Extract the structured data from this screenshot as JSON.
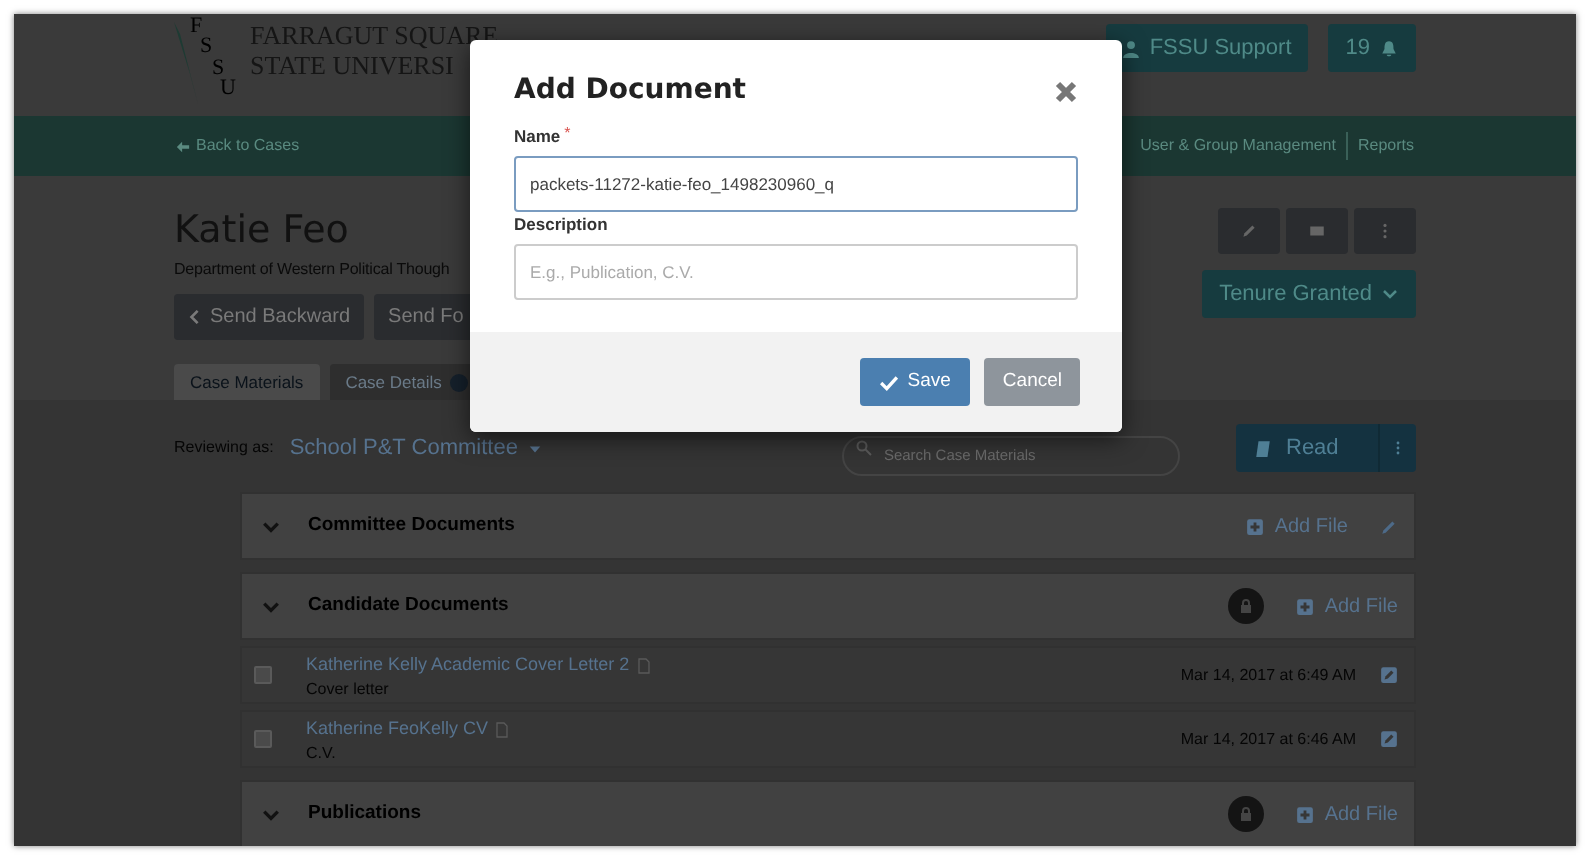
{
  "header": {
    "logo_letters": [
      "F",
      "S",
      "S",
      "U"
    ],
    "logo_lines": [
      "FARRAGUT SQUARE",
      "STATE UNIVERSI"
    ],
    "support_button": "FSSU Support",
    "notification_count": "19"
  },
  "nav": {
    "back_link": "Back to Cases",
    "links": [
      "User & Group Management",
      "Reports"
    ]
  },
  "case": {
    "name": "Katie Feo",
    "department": "Department of Western Political Though",
    "actions": [
      "Send Backward",
      "Send Fo"
    ],
    "status": "Tenure Granted"
  },
  "tabs": [
    {
      "label": "Case Materials",
      "selected": true
    },
    {
      "label": "Case Details",
      "selected": false
    }
  ],
  "reviewing": {
    "label": "Reviewing as:",
    "value": "School P&T Committee"
  },
  "search": {
    "placeholder": "Search Case Materials"
  },
  "read_button": "Read",
  "sections": [
    {
      "title": "Committee Documents",
      "locked": false,
      "editable": true,
      "add_label": "Add File"
    },
    {
      "title": "Candidate Documents",
      "locked": true,
      "editable": false,
      "add_label": "Add File",
      "files": [
        {
          "name": "Katherine Kelly Academic Cover Letter 2",
          "type": "Cover letter",
          "date": "Mar 14, 2017 at 6:49 AM",
          "checked": false
        },
        {
          "name": "Katherine FeoKelly CV",
          "type": "C.V.",
          "date": "Mar 14, 2017 at 6:46 AM",
          "checked": false
        }
      ]
    },
    {
      "title": "Publications",
      "locked": true,
      "editable": false,
      "add_label": "Add File"
    }
  ],
  "modal": {
    "title": "Add Document",
    "fields": [
      {
        "label": "Name",
        "required_mark": "*",
        "value": "packets-11272-katie-feo_1498230960_q"
      },
      {
        "label": "Description",
        "placeholder": "E.g., Publication, C.V."
      }
    ],
    "save_button": "Save",
    "cancel_button": "Cancel"
  }
}
